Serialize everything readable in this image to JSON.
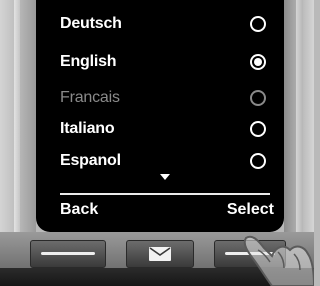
{
  "menu": {
    "items": [
      {
        "label": "Deutsch",
        "selected": false,
        "enabled": true
      },
      {
        "label": "English",
        "selected": true,
        "enabled": true
      },
      {
        "label": "Francais",
        "selected": false,
        "enabled": false
      },
      {
        "label": "Italiano",
        "selected": false,
        "enabled": true
      },
      {
        "label": "Espanol",
        "selected": false,
        "enabled": true
      }
    ],
    "more_indicator": "down-arrow-icon"
  },
  "softkeys": {
    "left_label": "Back",
    "right_label": "Select"
  },
  "hardware_keys": {
    "left": "display-key-left",
    "center": "message-envelope-icon",
    "right": "display-key-right"
  },
  "colors": {
    "screen_background": "#000000",
    "text": "#ffffff",
    "disabled_text": "#8a8a8a",
    "bezel": "#b9b9b9"
  }
}
